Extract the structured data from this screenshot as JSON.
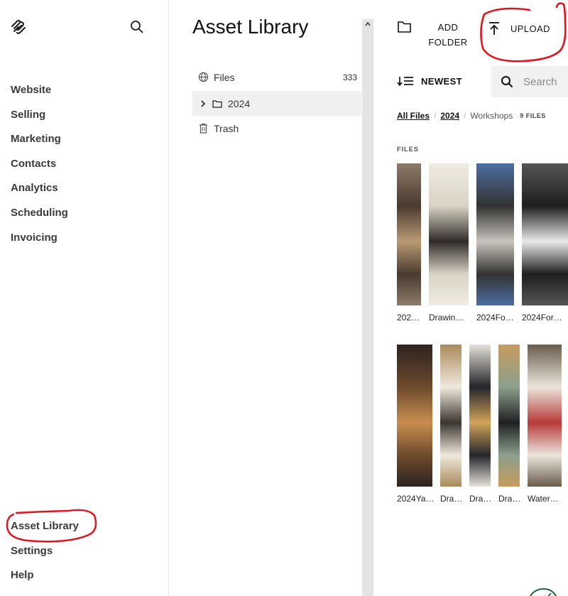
{
  "nav": {
    "items": [
      "Website",
      "Selling",
      "Marketing",
      "Contacts",
      "Analytics",
      "Scheduling",
      "Invoicing"
    ],
    "bottom": [
      "Asset Library",
      "Settings",
      "Help"
    ]
  },
  "library": {
    "title": "Asset Library",
    "tree": [
      {
        "label": "Files",
        "count": "333",
        "icon": "globe-icon"
      },
      {
        "label": "2024",
        "icon": "folder-icon",
        "selected": true
      },
      {
        "label": "Trash",
        "icon": "trash-icon"
      }
    ]
  },
  "toolbar": {
    "add_folder": [
      "ADD",
      "FOLDER"
    ],
    "upload": "UPLOAD",
    "sort": "NEWEST",
    "search_placeholder": "Search"
  },
  "breadcrumb": {
    "all_files": "All Files",
    "year": "2024",
    "current": "Workshops",
    "count": "9 FILES"
  },
  "files_heading": "FILES",
  "files": [
    {
      "name": "202…",
      "colors": [
        "#4a3a2e",
        "#b99a74",
        "#8d7b6a"
      ]
    },
    {
      "name": "Drawin…",
      "colors": [
        "#d9d3c4",
        "#2f2b2a",
        "#f0ece4"
      ]
    },
    {
      "name": "2024Fo…",
      "colors": [
        "#333230",
        "#c9c4be",
        "#4c6fa3"
      ]
    },
    {
      "name": "2024For…",
      "colors": [
        "#1e1e1e",
        "#e9e9e9",
        "#555"
      ]
    },
    {
      "name": "2024Ya…",
      "colors": [
        "#6e4a2c",
        "#c88e4f",
        "#2d2320"
      ]
    },
    {
      "name": "Dra…",
      "colors": [
        "#efe9dd",
        "#3b3530",
        "#a98a5a"
      ]
    },
    {
      "name": "Dra…",
      "colors": [
        "#24252a",
        "#d2a35a",
        "#e6e2da"
      ]
    },
    {
      "name": "Dra…",
      "colors": [
        "#8ba08c",
        "#1f1f22",
        "#c89b5e"
      ]
    },
    {
      "name": "Water…",
      "colors": [
        "#ebe6dc",
        "#b63a3a",
        "#6a5c4c"
      ]
    }
  ],
  "colors": {
    "annotation": "#e0141e",
    "selected_row": "#f0f0f0",
    "scrollbar": "#e4e4e4"
  }
}
